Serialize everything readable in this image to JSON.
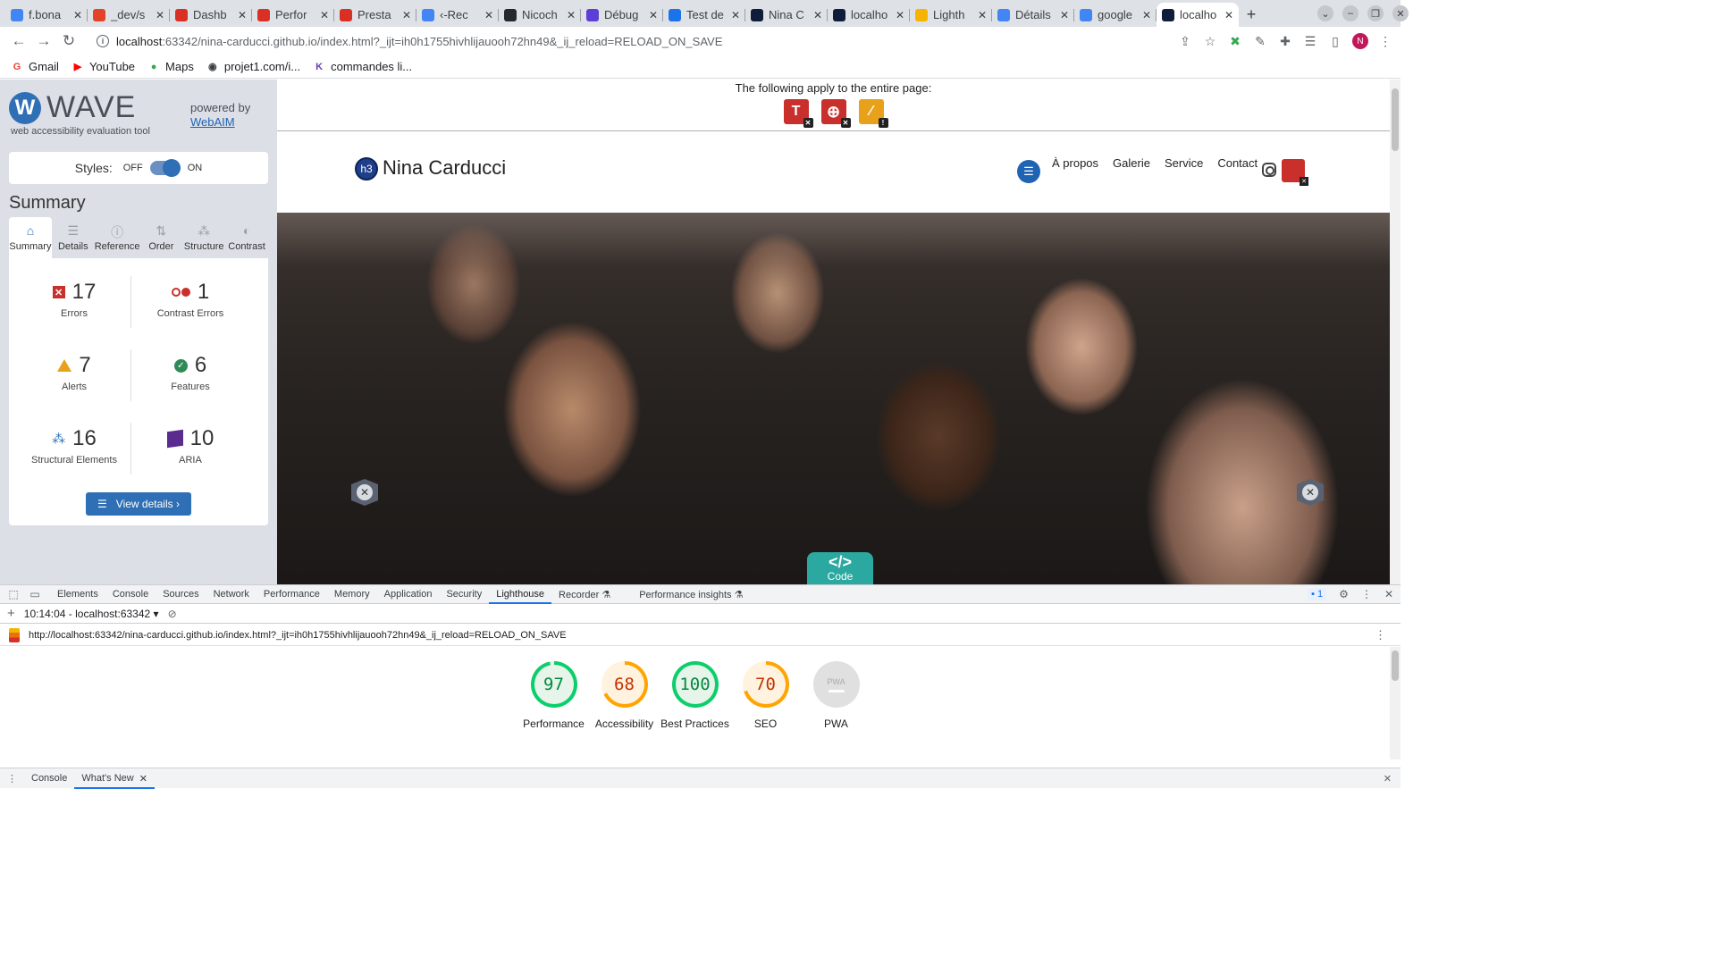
{
  "browser": {
    "tabs": [
      {
        "title": "f.bona",
        "favicon_color": "#4285f4"
      },
      {
        "title": "_dev/s",
        "favicon_color": "#e24329"
      },
      {
        "title": "Dashb",
        "favicon_color": "#d93025"
      },
      {
        "title": "Perfor",
        "favicon_color": "#d93025"
      },
      {
        "title": "Presta",
        "favicon_color": "#d93025"
      },
      {
        "title": "‹-Rec",
        "favicon_color": "#4285f4"
      },
      {
        "title": "Nicoch",
        "favicon_color": "#24292e"
      },
      {
        "title": "Débug",
        "favicon_color": "#5b3fd6"
      },
      {
        "title": "Test de",
        "favicon_color": "#1a73e8"
      },
      {
        "title": "Nina C",
        "favicon_color": "#0f1d3b"
      },
      {
        "title": "localho",
        "favicon_color": "#0f1d3b"
      },
      {
        "title": "Lighth",
        "favicon_color": "#f4b400"
      },
      {
        "title": "Détails",
        "favicon_color": "#4285f4"
      },
      {
        "title": "google",
        "favicon_color": "#4285f4"
      },
      {
        "title": "localho",
        "favicon_color": "#0f1d3b"
      }
    ],
    "new_tab": "+",
    "url_host": "localhost",
    "url_rest": ":63342/nina-carducci.github.io/index.html?_ijt=ih0h1755hivhlijauooh72hn49&_ij_reload=RELOAD_ON_SAVE",
    "profile_initial": "N",
    "bookmarks": [
      {
        "label": "Gmail",
        "icon": "G",
        "color": "#ea4335"
      },
      {
        "label": "YouTube",
        "icon": "▶",
        "color": "#ff0000"
      },
      {
        "label": "Maps",
        "icon": "●",
        "color": "#34a853"
      },
      {
        "label": "projet1.com/i...",
        "icon": "◉",
        "color": "#3c4043"
      },
      {
        "label": "commandes li...",
        "icon": "K",
        "color": "#6a3fb5"
      }
    ]
  },
  "wave": {
    "logo_letter": "W",
    "name": "WAVE",
    "subtitle": "web accessibility evaluation tool",
    "powered_by": "powered by",
    "powered_link": "WebAIM",
    "styles_label": "Styles:",
    "off_label": "OFF",
    "on_label": "ON",
    "summary_title": "Summary",
    "tabs": [
      {
        "label": "Summary",
        "icon": "⌂"
      },
      {
        "label": "Details",
        "icon": "☰"
      },
      {
        "label": "Reference",
        "icon": "ⓘ"
      },
      {
        "label": "Order",
        "icon": "⇅"
      },
      {
        "label": "Structure",
        "icon": "⁂"
      },
      {
        "label": "Contrast",
        "icon": "◐"
      }
    ],
    "stats": {
      "errors": {
        "count": "17",
        "label": "Errors"
      },
      "contrast": {
        "count": "1",
        "label": "Contrast Errors"
      },
      "alerts": {
        "count": "7",
        "label": "Alerts"
      },
      "features": {
        "count": "6",
        "label": "Features"
      },
      "structural": {
        "count": "16",
        "label": "Structural Elements"
      },
      "aria": {
        "count": "10",
        "label": "ARIA"
      }
    },
    "view_details": "View details ›"
  },
  "page": {
    "banner_text": "The following apply to the entire page:",
    "h3_badge": "h3",
    "site_title": "Nina Carducci",
    "nav": [
      "À propos",
      "Galerie",
      "Service",
      "Contact"
    ],
    "code_label": "Code"
  },
  "devtools": {
    "tabs": [
      "Elements",
      "Console",
      "Sources",
      "Network",
      "Performance",
      "Memory",
      "Application",
      "Security",
      "Lighthouse",
      "Recorder ⚗",
      "Performance insights ⚗"
    ],
    "active_tab": "Lighthouse",
    "issues_count": "1",
    "report_selector": "10:14:04 - localhost:63342 ▾",
    "report_url": "http://localhost:63342/nina-carducci.github.io/index.html?_ijt=ih0h1755hivhlijauooh72hn49&_ij_reload=RELOAD_ON_SAVE",
    "scores": [
      {
        "value": "97",
        "label": "Performance",
        "color": "green"
      },
      {
        "value": "68",
        "label": "Accessibility",
        "color": "orange"
      },
      {
        "value": "100",
        "label": "Best Practices",
        "color": "green"
      },
      {
        "value": "70",
        "label": "SEO",
        "color": "orange"
      },
      {
        "value": "PWA",
        "label": "PWA",
        "color": "gray"
      }
    ],
    "drawer_tabs": [
      "Console",
      "What's New"
    ]
  }
}
